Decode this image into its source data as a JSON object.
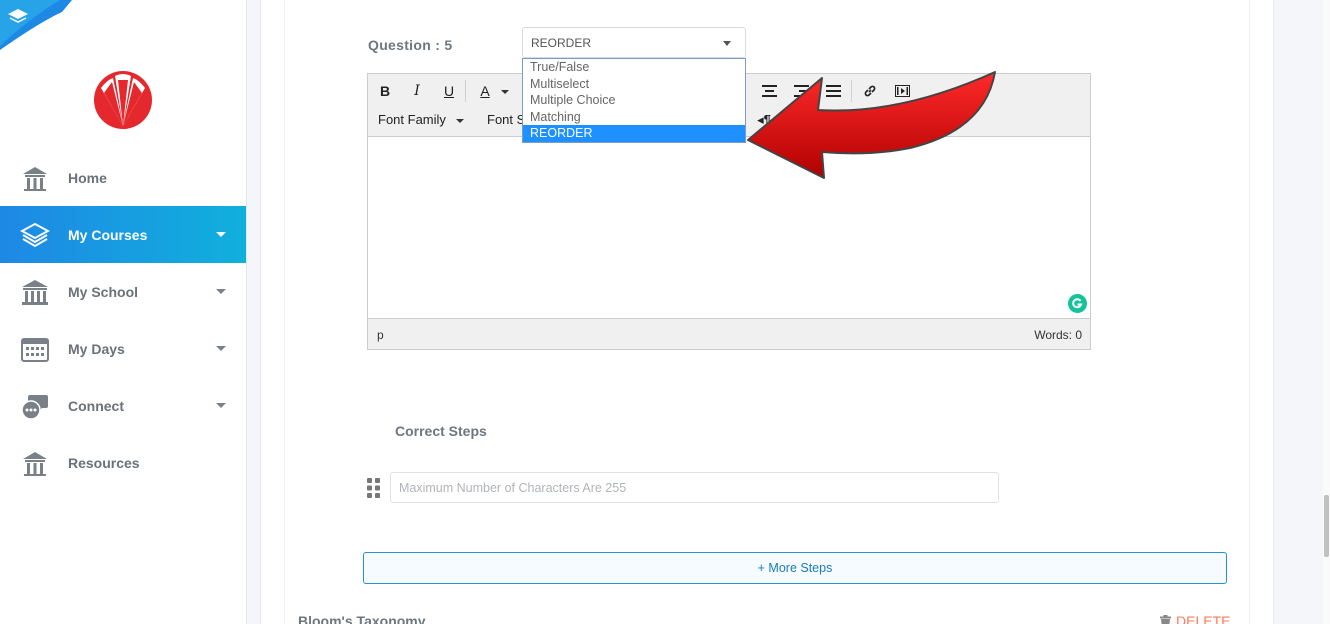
{
  "sidebar": {
    "items": [
      {
        "label": "Home",
        "icon": "home-icon"
      },
      {
        "label": "My Courses",
        "icon": "layers-icon",
        "active": true
      },
      {
        "label": "My School",
        "icon": "school-icon"
      },
      {
        "label": "My Days",
        "icon": "calendar-icon"
      },
      {
        "label": "Connect",
        "icon": "chat-icon"
      },
      {
        "label": "Resources",
        "icon": "resources-icon"
      }
    ],
    "active_color": "#1e88e5"
  },
  "question": {
    "label": "Question : 5",
    "type_value": "REORDER",
    "type_options": [
      "True/False",
      "Multiselect",
      "Multiple Choice",
      "Matching",
      "REORDER"
    ]
  },
  "editor": {
    "font_family": "Font Family",
    "font_size": "Font S",
    "status_path": "p",
    "words": "Words: 0"
  },
  "steps": {
    "title": "Correct Steps",
    "placeholder": "Maximum Number of Characters Are 255",
    "more_label": "+ More Steps"
  },
  "footer": {
    "blooms": "Bloom's Taxonomy",
    "delete": "DELETE"
  },
  "colors": {
    "accent": "#1e90ff",
    "arrow": "#d90000",
    "delete": "#ff7a59"
  }
}
